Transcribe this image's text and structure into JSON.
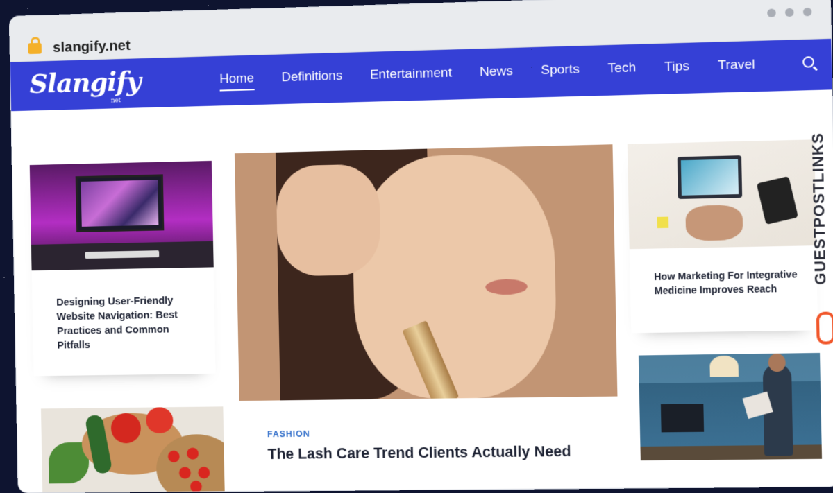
{
  "browser": {
    "url": "slangify.net"
  },
  "site": {
    "logo": "Slangify",
    "logo_sub": "net",
    "nav": [
      {
        "label": "Home",
        "active": true
      },
      {
        "label": "Definitions"
      },
      {
        "label": "Entertainment"
      },
      {
        "label": "News"
      },
      {
        "label": "Sports"
      },
      {
        "label": "Tech"
      },
      {
        "label": "Tips"
      },
      {
        "label": "Travel"
      }
    ]
  },
  "cards": {
    "left_top_title": "Designing User-Friendly Website Navigation: Best Practices and Common Pitfalls",
    "right_top_title": "How Marketing For Integrative Medicine Improves Reach",
    "main_category": "FASHION",
    "main_title": "The Lash Care Trend Clients Actually Need"
  },
  "watermark": {
    "text": "GUESTPOSTLINKS"
  },
  "colors": {
    "nav_bg": "#3540d6",
    "category": "#2e6cc9",
    "watermark_accent": "#f1572b"
  }
}
